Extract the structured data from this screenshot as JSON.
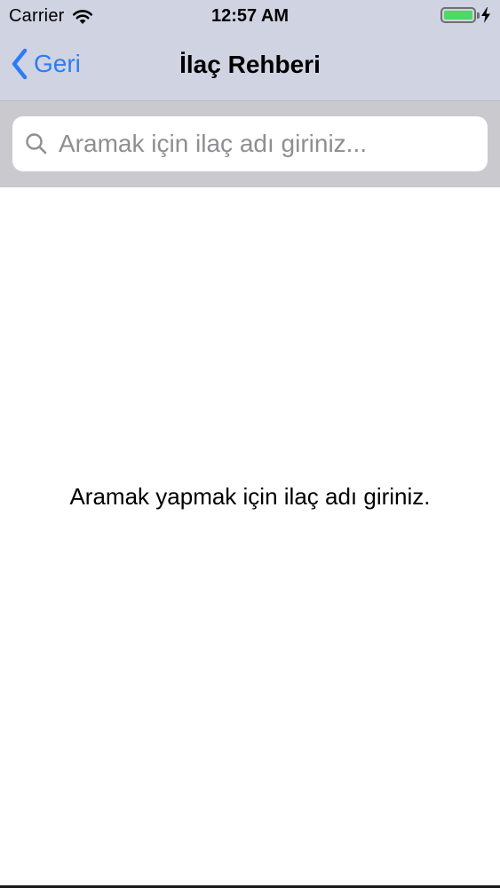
{
  "status_bar": {
    "carrier": "Carrier",
    "time": "12:57 AM",
    "battery_level": 1.0,
    "charging": true,
    "icons": [
      "wifi-icon",
      "battery-icon",
      "charging-bolt-icon"
    ]
  },
  "nav": {
    "back_label": "Geri",
    "title": "İlaç Rehberi",
    "accent_color": "#2c7cf6"
  },
  "search": {
    "placeholder": "Aramak için ilaç adı giriniz...",
    "value": "",
    "icon": "search-icon"
  },
  "content": {
    "empty_message": "Aramak yapmak için ilaç adı giriniz."
  },
  "colors": {
    "nav_background": "#d0d3e2",
    "search_bar_background": "#c9c9ce",
    "battery_fill": "#4cd964"
  }
}
